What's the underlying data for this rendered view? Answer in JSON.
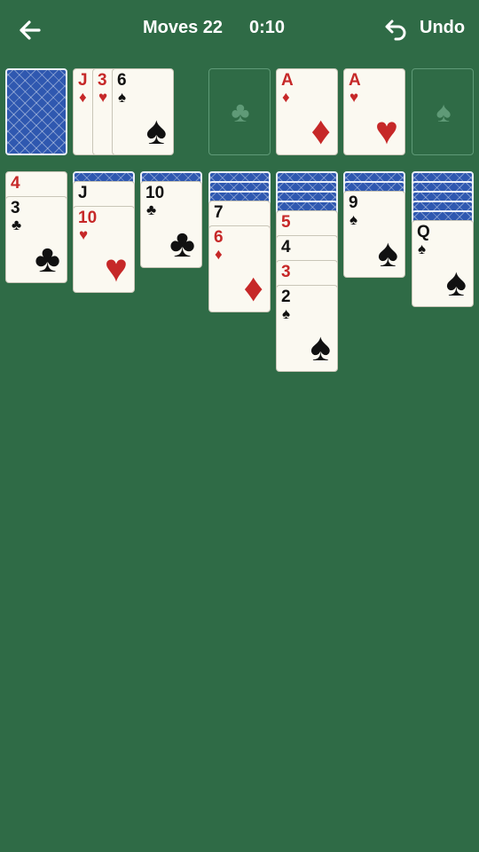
{
  "header": {
    "back_icon": "arrow-left-icon",
    "moves_label": "Moves 22",
    "timer": "0:10",
    "undo_label": "Undo",
    "undo_icon": "undo-arrow-icon"
  },
  "colors": {
    "felt": "#2f6b46",
    "card_face": "#fbf9f1",
    "card_back": "#2f58b0",
    "red_suit": "#c62828",
    "empty_slot_outline": "#5f9a77"
  },
  "stock": {
    "face_down": true
  },
  "waste": [
    {
      "rank": "J",
      "suit": "♦",
      "color": "red"
    },
    {
      "rank": "3",
      "suit": "♥",
      "color": "red"
    },
    {
      "rank": "6",
      "suit": "♠",
      "color": "black"
    }
  ],
  "foundations": [
    {
      "empty": true,
      "suit_icon": "♣"
    },
    {
      "rank": "A",
      "suit": "♦",
      "color": "red"
    },
    {
      "rank": "A",
      "suit": "♥",
      "color": "red"
    },
    {
      "empty": true,
      "suit_icon": "♠"
    }
  ],
  "tableau": [
    {
      "face_down": 0,
      "cards": [
        {
          "rank": "4",
          "suit": "",
          "color": "red"
        },
        {
          "rank": "3",
          "suit": "♣",
          "color": "black"
        }
      ]
    },
    {
      "face_down": 1,
      "cards": [
        {
          "rank": "J",
          "suit": "",
          "color": "black"
        },
        {
          "rank": "10",
          "suit": "♥",
          "color": "red"
        }
      ]
    },
    {
      "face_down": 1,
      "cards": [
        {
          "rank": "10",
          "suit": "♣",
          "color": "black"
        }
      ]
    },
    {
      "face_down": 3,
      "cards": [
        {
          "rank": "7",
          "suit": "",
          "color": "black"
        },
        {
          "rank": "6",
          "suit": "♦",
          "color": "red"
        }
      ]
    },
    {
      "face_down": 4,
      "cards": [
        {
          "rank": "5",
          "suit": "",
          "color": "red"
        },
        {
          "rank": "4",
          "suit": "",
          "color": "black"
        },
        {
          "rank": "3",
          "suit": "",
          "color": "red"
        },
        {
          "rank": "2",
          "suit": "♠",
          "color": "black"
        }
      ]
    },
    {
      "face_down": 2,
      "cards": [
        {
          "rank": "9",
          "suit": "♠",
          "color": "black"
        }
      ]
    },
    {
      "face_down": 5,
      "cards": [
        {
          "rank": "Q",
          "suit": "♠",
          "color": "black"
        }
      ]
    }
  ]
}
